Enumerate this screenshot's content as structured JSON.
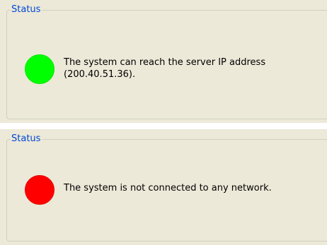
{
  "panels": [
    {
      "legend": "Status",
      "indicator": {
        "color_name": "green",
        "color": "#00ff00"
      },
      "message_line1": "The system can reach the server IP address",
      "message_line2": "(200.40.51.36)."
    },
    {
      "legend": "Status",
      "indicator": {
        "color_name": "red",
        "color": "#ff0000"
      },
      "message_line1": "The system is not connected to any network."
    }
  ],
  "colors": {
    "panel_bg": "#ece9d8",
    "legend_text": "#0046d5",
    "groupbox_border": "#d0d0bf"
  }
}
